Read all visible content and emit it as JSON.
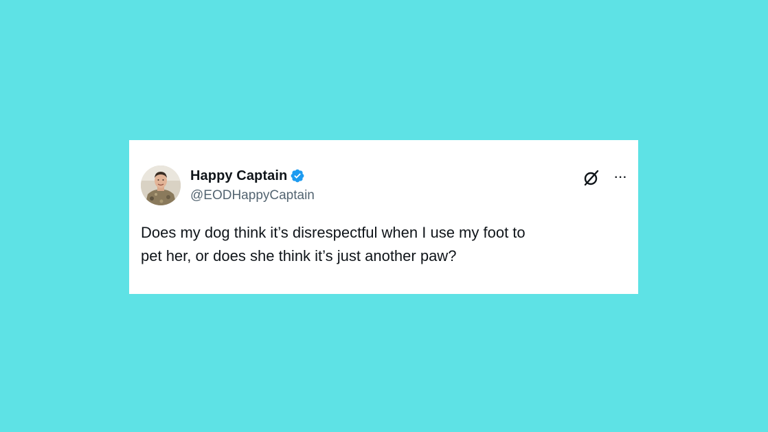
{
  "tweet": {
    "display_name": "Happy Captain",
    "handle": "@EODHappyCaptain",
    "text": "Does my dog think it’s disrespectful when I use my foot to\npet her, or does she think it’s just another paw?",
    "more_label": "···"
  },
  "icons": {
    "verified": "verified-badge-icon",
    "grok": "grok-icon",
    "more": "more-options-icon"
  },
  "colors": {
    "background": "#5ee2e5",
    "card": "#ffffff",
    "verified": "#1d9bf0",
    "text": "#0f1419",
    "secondary_text": "#536471"
  }
}
